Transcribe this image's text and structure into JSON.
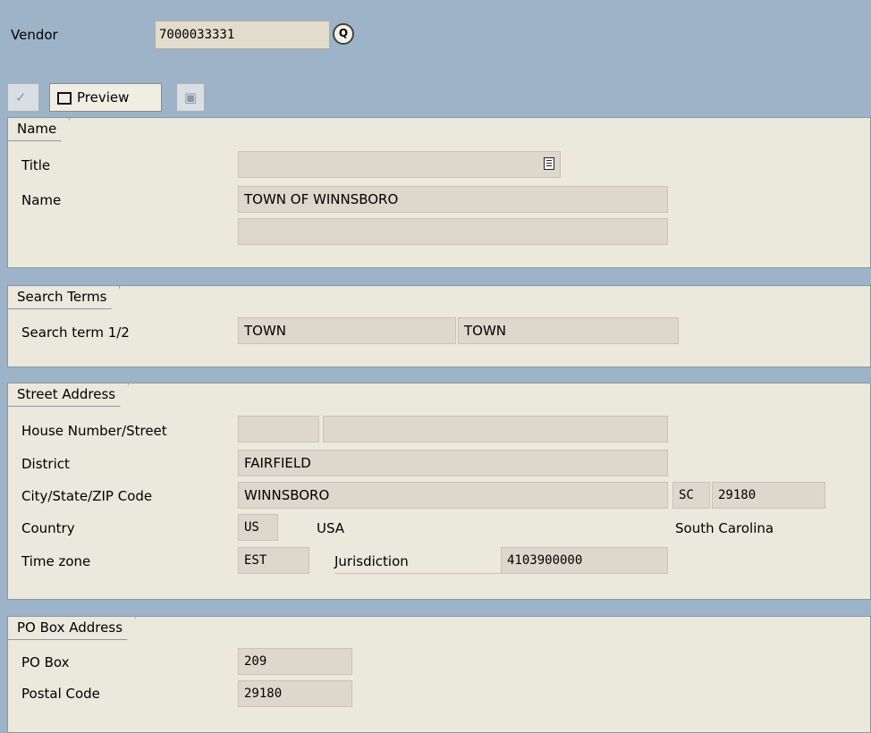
{
  "vendor": {
    "label": "Vendor",
    "value": "7000033331"
  },
  "toolbar": {
    "preview_label": "Preview"
  },
  "name_group": {
    "title": "Name",
    "title_label": "Title",
    "title_value": "",
    "name_label": "Name",
    "name_value": "TOWN OF WINNSBORO",
    "name2_value": ""
  },
  "search_group": {
    "title": "Search Terms",
    "label": "Search term 1/2",
    "term1": "TOWN",
    "term2": "TOWN"
  },
  "address_group": {
    "title": "Street Address",
    "house_label": "House Number/Street",
    "house_number": "",
    "street": "",
    "district_label": "District",
    "district": "FAIRFIELD",
    "city_label": "City/State/ZIP Code",
    "city": "WINNSBORO",
    "state": "SC",
    "zip": "29180",
    "country_label": "Country",
    "country_code": "US",
    "country_name": "USA",
    "region_name": "South Carolina",
    "timezone_label": "Time zone",
    "timezone": "EST",
    "jurisdiction_label": "Jurisdiction",
    "jurisdiction": "4103900000"
  },
  "pobox_group": {
    "title": "PO Box Address",
    "pobox_label": "PO Box",
    "pobox": "209",
    "postal_label": "Postal Code",
    "postal_code": "29180"
  }
}
